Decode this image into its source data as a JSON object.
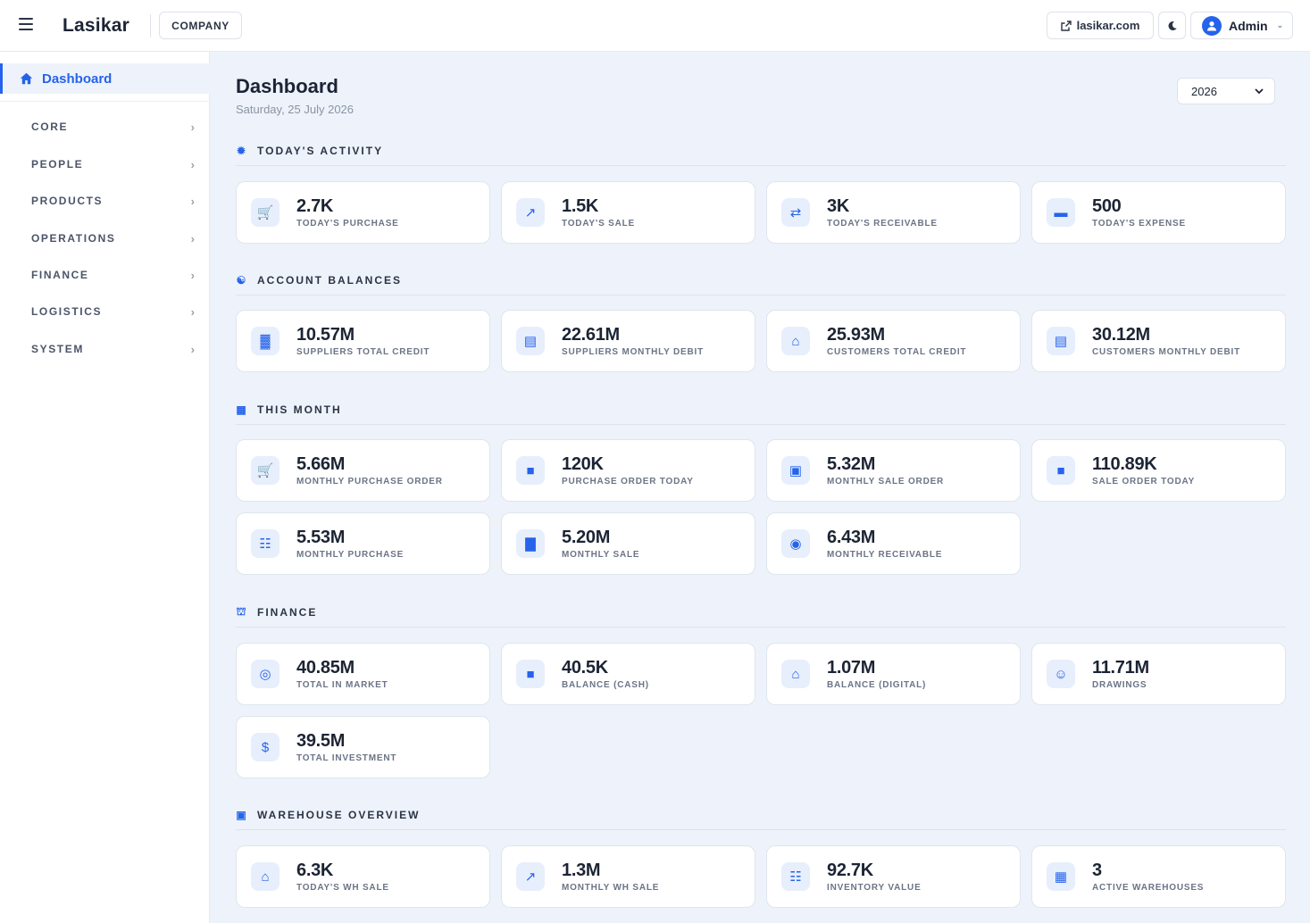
{
  "header": {
    "logo": "Lasikar",
    "company_label": "COMPANY",
    "site_link": "lasikar.com",
    "user_name": "Admin"
  },
  "sidebar": {
    "active": {
      "label": "Dashboard",
      "icon": "home-icon"
    },
    "items": [
      {
        "label": "CORE"
      },
      {
        "label": "PEOPLE"
      },
      {
        "label": "PRODUCTS"
      },
      {
        "label": "OPERATIONS"
      },
      {
        "label": "FINANCE"
      },
      {
        "label": "LOGISTICS"
      },
      {
        "label": "SYSTEM"
      }
    ]
  },
  "page": {
    "title": "Dashboard",
    "date": "Saturday, 25 July 2026",
    "year": "2026"
  },
  "sections": {
    "activity": {
      "title": "TODAY'S ACTIVITY",
      "cards": [
        {
          "value": "2.7K",
          "label": "TODAY'S PURCHASE",
          "icon": "cart-plus-icon"
        },
        {
          "value": "1.5K",
          "label": "TODAY'S SALE",
          "icon": "chart-line-icon"
        },
        {
          "value": "3K",
          "label": "TODAY'S RECEIVABLE",
          "icon": "money-exchange-icon"
        },
        {
          "value": "500",
          "label": "TODAY'S EXPENSE",
          "icon": "money-bill-icon"
        }
      ]
    },
    "balances": {
      "title": "ACCOUNT BALANCES",
      "cards": [
        {
          "value": "10.57M",
          "label": "SUPPLIERS TOTAL CREDIT",
          "icon": "industry-icon"
        },
        {
          "value": "22.61M",
          "label": "SUPPLIERS MONTHLY DEBIT",
          "icon": "credit-card-icon"
        },
        {
          "value": "25.93M",
          "label": "CUSTOMERS TOTAL CREDIT",
          "icon": "store-icon"
        },
        {
          "value": "30.12M",
          "label": "CUSTOMERS MONTHLY DEBIT",
          "icon": "credit-card-icon"
        }
      ]
    },
    "month": {
      "title": "THIS MONTH",
      "cards": [
        {
          "value": "5.66M",
          "label": "MONTHLY PURCHASE ORDER",
          "icon": "cart-icon"
        },
        {
          "value": "120K",
          "label": "PURCHASE ORDER TODAY",
          "icon": "file-icon"
        },
        {
          "value": "5.32M",
          "label": "MONTHLY SALE ORDER",
          "icon": "file-invoice-icon"
        },
        {
          "value": "110.89K",
          "label": "SALE ORDER TODAY",
          "icon": "file-icon"
        },
        {
          "value": "5.53M",
          "label": "MONTHLY PURCHASE",
          "icon": "boxes-icon"
        },
        {
          "value": "5.20M",
          "label": "MONTHLY SALE",
          "icon": "chart-bar-icon"
        },
        {
          "value": "6.43M",
          "label": "MONTHLY RECEIVABLE",
          "icon": "coins-icon"
        }
      ]
    },
    "finance": {
      "title": "FINANCE",
      "cards": [
        {
          "value": "40.85M",
          "label": "TOTAL IN MARKET",
          "icon": "globe-icon"
        },
        {
          "value": "40.5K",
          "label": "BALANCE (CASH)",
          "icon": "wallet-icon"
        },
        {
          "value": "1.07M",
          "label": "BALANCE (DIGITAL)",
          "icon": "bank-icon"
        },
        {
          "value": "11.71M",
          "label": "DRAWINGS",
          "icon": "user-pen-icon"
        },
        {
          "value": "39.5M",
          "label": "TOTAL INVESTMENT",
          "icon": "hand-dollar-icon"
        }
      ]
    },
    "warehouse": {
      "title": "WAREHOUSE OVERVIEW",
      "cards": [
        {
          "value": "6.3K",
          "label": "TODAY'S WH SALE",
          "icon": "warehouse-icon"
        },
        {
          "value": "1.3M",
          "label": "MONTHLY WH SALE",
          "icon": "chart-line-icon"
        },
        {
          "value": "92.7K",
          "label": "INVENTORY VALUE",
          "icon": "boxes-icon"
        },
        {
          "value": "3",
          "label": "ACTIVE WAREHOUSES",
          "icon": "building-icon"
        }
      ]
    }
  },
  "colors": {
    "accent": "#2563eb",
    "page_bg": "#eef3fb",
    "icon_bg": "#e7eefc"
  }
}
